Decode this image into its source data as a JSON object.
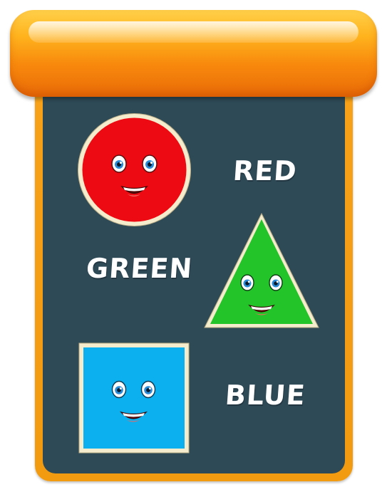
{
  "labels": {
    "red": "RED",
    "green": "GREEN",
    "blue": "BLUE"
  },
  "shapes": [
    {
      "kind": "circle",
      "fill": "#ee0a12",
      "border": "#f5eccd",
      "icon": "red-circle-face"
    },
    {
      "kind": "triangle",
      "fill": "#22c42a",
      "border": "#f5eccd",
      "icon": "green-triangle-face"
    },
    {
      "kind": "square",
      "fill": "#0db0ef",
      "border": "#f5eccd",
      "icon": "blue-square-face"
    }
  ],
  "colors": {
    "header": "#f88a0d",
    "frame": "#f29a10",
    "board": "#2e4a57",
    "label_text": "#ffffff"
  }
}
